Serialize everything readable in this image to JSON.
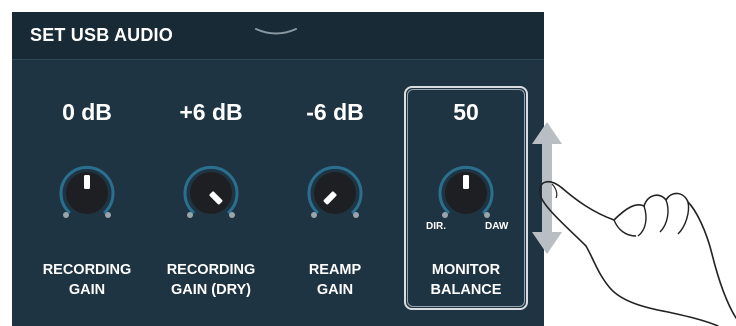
{
  "header": {
    "title": "SET USB AUDIO"
  },
  "knobs": [
    {
      "value": "0 dB",
      "label_line1": "RECORDING",
      "label_line2": "GAIN"
    },
    {
      "value": "+6 dB",
      "label_line1": "RECORDING",
      "label_line2": "GAIN (DRY)"
    },
    {
      "value": "-6 dB",
      "label_line1": "REAMP",
      "label_line2": "GAIN"
    },
    {
      "value": "50",
      "label_line1": "MONITOR",
      "label_line2": "BALANCE",
      "left_label": "DIR.",
      "right_label": "DAW"
    }
  ],
  "colors": {
    "panel": "#1f3442",
    "header": "#172a36",
    "knob_ring": "#2b6f8f",
    "knob_body": "#1d1f22",
    "indicator": "#ffffff"
  },
  "icons": {
    "handle": "chevron-down-icon",
    "swipe": "vertical-swipe-arrow-icon",
    "hand": "pointing-hand-icon"
  }
}
